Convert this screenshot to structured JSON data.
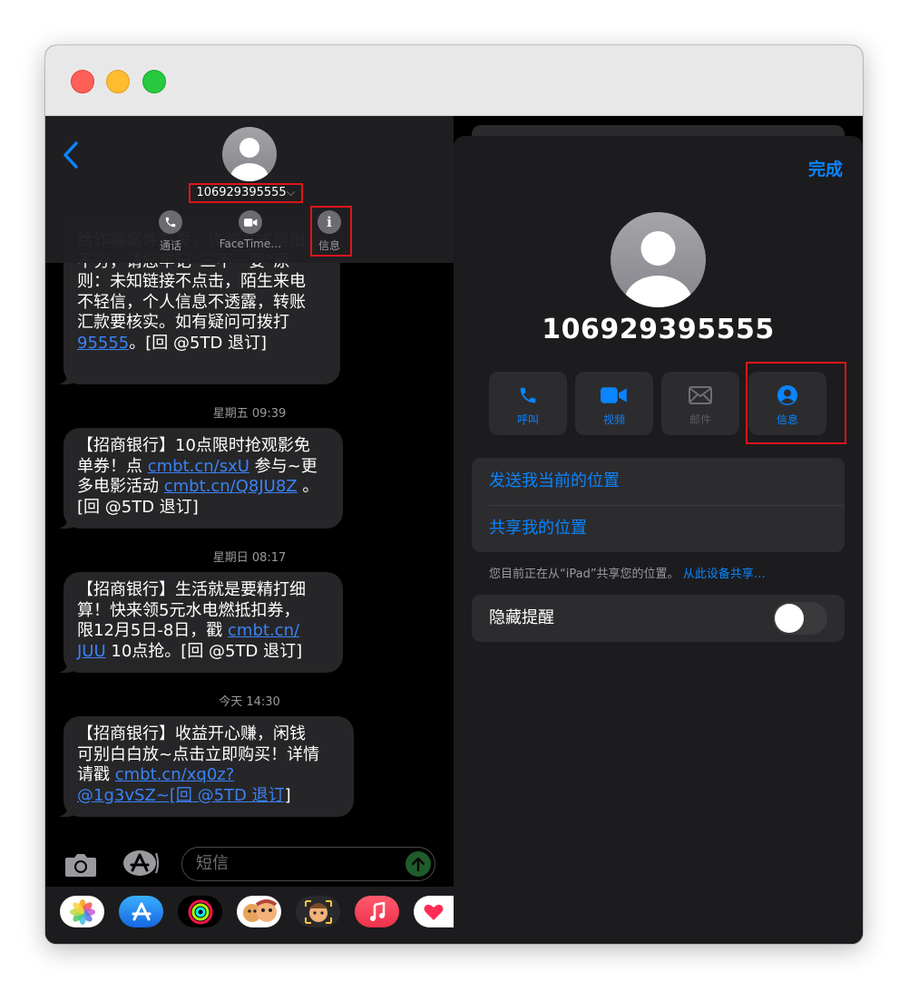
{
  "messages": {
    "items": [
      {
        "pre": "给诈骗案件高发，诈骗方式层出\n不穷，请您牢记“三不一要”原\n则：未知链接不点击，陌生来电\n不轻信，个人信息不透露，转账\n汇款要核实。如有疑问可拨打\n",
        "link1": "95555",
        "mid": "。[回 @5TD 退订]",
        "link2": "",
        "post": ""
      },
      {
        "stamp": "星期五 09:39",
        "pre": "【招商银行】10点限时抢观影免\n单券！点 ",
        "link1": "cmbt.cn/sxU",
        "mid": " 参与~更\n多电影活动 ",
        "link2": "cmbt.cn/Q8JU8Z",
        "post": " 。\n[回 @5TD 退订]"
      },
      {
        "stamp": "星期日 08:17",
        "pre": "【招商银行】生活就是要精打细\n算！快来领5元水电燃抵扣券，\n限12月5日-8日，戳 ",
        "link1": "cmbt.cn/\nJUU",
        "mid": " 10点抢。[回 @5TD 退订]",
        "link2": "",
        "post": ""
      },
      {
        "stamp": "今天 14:30",
        "pre": "【招商银行】收益开心赚，闲钱\n可别白白放~点击立即购买！详情\n请戳 ",
        "link1": "cmbt.cn/xq0z?\n@1g3vSZ~[回 @5TD 退订",
        "mid": "]",
        "link2": "",
        "post": ""
      }
    ]
  },
  "conversation": {
    "contact": "106929395555",
    "chevron": "⌵",
    "buttons": {
      "call": "通话",
      "facetime": "FaceTime…",
      "info": "信息"
    }
  },
  "composer": {
    "placeholder": "短信"
  },
  "dock": {
    "apps": [
      "photos-icon",
      "app-store-icon",
      "activity-icon",
      "memoji-icon",
      "memoji-stickers-icon",
      "music-icon",
      "digital-touch-icon"
    ]
  },
  "details": {
    "done": "完成",
    "name": "106929395555",
    "actions": {
      "call": "呼叫",
      "video": "视频",
      "mail": "邮件",
      "info": "信息"
    },
    "send_location": "发送我当前的位置",
    "share_location": "共享我的位置",
    "footnote": "您目前正在从“iPad”共享您的位置。",
    "footnote_link": "从此设备共享…",
    "hide_alerts": "隐藏提醒",
    "hide_alerts_on": false
  },
  "colors": {
    "accent": "#0a84ff",
    "bubble": "#262628",
    "highlight": "#e0141b"
  }
}
